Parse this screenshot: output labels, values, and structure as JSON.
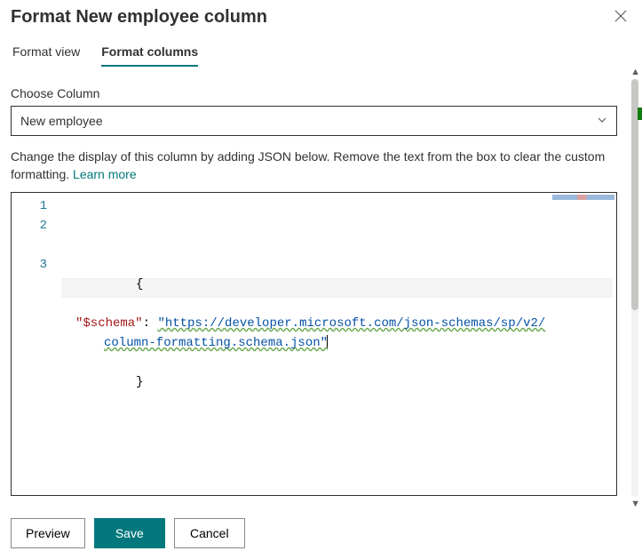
{
  "header": {
    "title": "Format New employee column"
  },
  "tabs": {
    "view": "Format view",
    "columns": "Format columns"
  },
  "column_picker": {
    "label": "Choose Column",
    "selected": "New employee"
  },
  "help": {
    "text": "Change the display of this column by adding JSON below. Remove the text from the box to clear the custom formatting. ",
    "link": "Learn more"
  },
  "editor": {
    "line_numbers": [
      "1",
      "2",
      "3"
    ],
    "brace_open": "{",
    "schema_key": "\"$schema\"",
    "colon": ": ",
    "schema_value_part1": "\"https://developer.microsoft.com/json-schemas/sp/v2/",
    "schema_value_part2": "column-formatting.schema.json\"",
    "brace_close": "}"
  },
  "footer": {
    "preview": "Preview",
    "save": "Save",
    "cancel": "Cancel"
  }
}
